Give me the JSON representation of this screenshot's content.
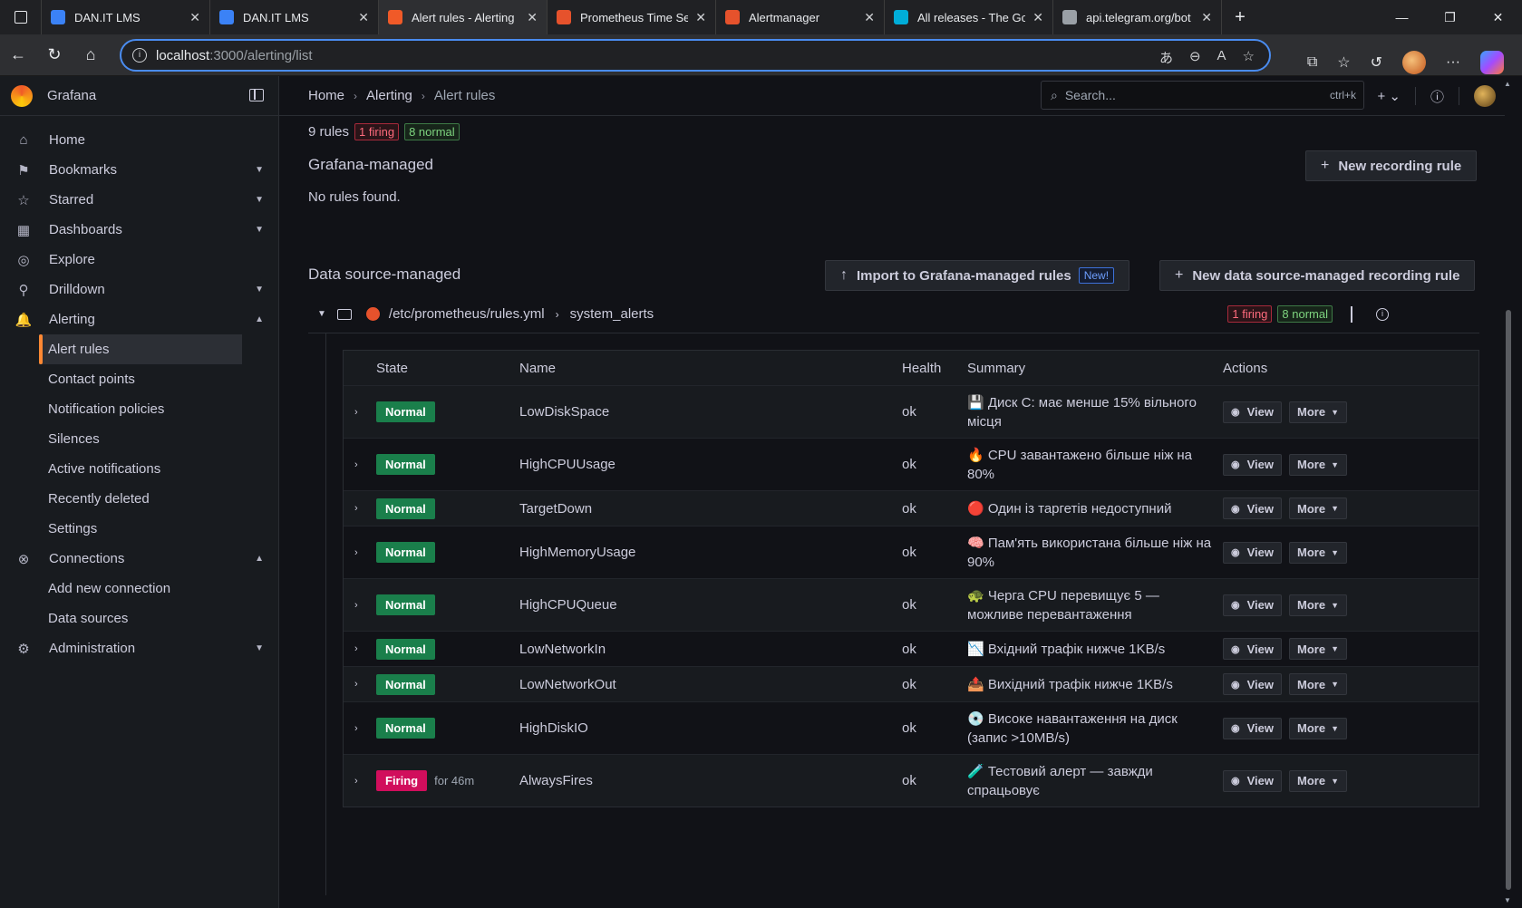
{
  "browser": {
    "tabs": [
      {
        "title": "DAN.IT LMS",
        "favicon_color": "#3b82f6"
      },
      {
        "title": "DAN.IT LMS",
        "favicon_color": "#3b82f6"
      },
      {
        "title": "Alert rules - Alerting",
        "favicon_color": "#f05a28"
      },
      {
        "title": "Prometheus Time Ser",
        "favicon_color": "#e6522c"
      },
      {
        "title": "Alertmanager",
        "favicon_color": "#e6522c"
      },
      {
        "title": "All releases - The Go",
        "favicon_color": "#00add8"
      },
      {
        "title": "api.telegram.org/bot",
        "favicon_color": "#9aa0a6"
      }
    ],
    "url_host": "localhost",
    "url_path": ":3000/alerting/list"
  },
  "sidebar": {
    "brand": "Grafana",
    "items": [
      {
        "label": "Home",
        "icon": "home-icon",
        "glyph": "⌂",
        "chevron": ""
      },
      {
        "label": "Bookmarks",
        "icon": "bookmark-icon",
        "glyph": "⚑",
        "chevron": "▼"
      },
      {
        "label": "Starred",
        "icon": "star-icon",
        "glyph": "☆",
        "chevron": "▼"
      },
      {
        "label": "Dashboards",
        "icon": "dashboards-icon",
        "glyph": "▦",
        "chevron": "▼"
      },
      {
        "label": "Explore",
        "icon": "compass-icon",
        "glyph": "◎",
        "chevron": ""
      },
      {
        "label": "Drilldown",
        "icon": "drilldown-icon",
        "glyph": "⚲",
        "chevron": "▼"
      },
      {
        "label": "Alerting",
        "icon": "bell-icon",
        "glyph": "🔔",
        "chevron": "▲"
      }
    ],
    "alerting_sub": [
      "Alert rules",
      "Contact points",
      "Notification policies",
      "Silences",
      "Active notifications",
      "Recently deleted",
      "Settings"
    ],
    "connections": {
      "label": "Connections",
      "icon": "connections-icon",
      "glyph": "⊗",
      "chevron": "▲"
    },
    "connections_sub": [
      "Add new connection",
      "Data sources"
    ],
    "administration": {
      "label": "Administration",
      "icon": "gear-icon",
      "glyph": "⚙",
      "chevron": "▼"
    }
  },
  "topbar": {
    "breadcrumb": [
      "Home",
      "Alerting",
      "Alert rules"
    ],
    "search_placeholder": "Search...",
    "search_shortcut": "ctrl+k"
  },
  "main": {
    "rules_count": "9 rules",
    "firing_badge": "1 firing",
    "normal_badge": "8 normal",
    "grafana_managed_title": "Grafana-managed",
    "no_rules": "No rules found.",
    "new_recording_rule": "New recording rule",
    "ds_managed_title": "Data source-managed",
    "import_button": "Import to Grafana-managed rules",
    "import_new_tag": "New!",
    "new_ds_recording_rule": "New data source-managed recording rule",
    "group": {
      "file": "/etc/prometheus/rules.yml",
      "name": "system_alerts",
      "firing": "1 firing",
      "normal": "8 normal"
    },
    "columns": [
      "State",
      "Name",
      "Health",
      "Summary",
      "Actions"
    ],
    "view_label": "View",
    "more_label": "More",
    "rules": [
      {
        "state": "Normal",
        "since": "",
        "name": "LowDiskSpace",
        "health": "ok",
        "summary": "💾 Диск C: має менше 15% вільного місця",
        "emoji_color": "#7b5cb8"
      },
      {
        "state": "Normal",
        "since": "",
        "name": "HighCPUUsage",
        "health": "ok",
        "summary": "🔥 CPU завантажено більше ніж на 80%",
        "emoji_color": "#e07a2c"
      },
      {
        "state": "Normal",
        "since": "",
        "name": "TargetDown",
        "health": "ok",
        "summary": "🔴 Один із таргетів недоступний",
        "emoji_color": "#d9303c"
      },
      {
        "state": "Normal",
        "since": "",
        "name": "HighMemoryUsage",
        "health": "ok",
        "summary": "🧠 Пам'ять використана більше ніж на 90%",
        "emoji_color": "#e98cc0"
      },
      {
        "state": "Normal",
        "since": "",
        "name": "HighCPUQueue",
        "health": "ok",
        "summary": "🐢 Черга CPU перевищує 5 — можливе перевантаження",
        "emoji_color": "#4a9a4a"
      },
      {
        "state": "Normal",
        "since": "",
        "name": "LowNetworkIn",
        "health": "ok",
        "summary": "📉 Вхідний трафік нижче 1KB/s",
        "emoji_color": "#d8506a"
      },
      {
        "state": "Normal",
        "since": "",
        "name": "LowNetworkOut",
        "health": "ok",
        "summary": "📤 Вихідний трафік нижче 1KB/s",
        "emoji_color": "#5a8ad8"
      },
      {
        "state": "Normal",
        "since": "",
        "name": "HighDiskIO",
        "health": "ok",
        "summary": "💿 Високе навантаження на диск (запис >10MB/s)",
        "emoji_color": "#9aa0b0"
      },
      {
        "state": "Firing",
        "since": "for 46m",
        "name": "AlwaysFires",
        "health": "ok",
        "summary": "🧪 Тестовий алерт — завжди спрацьовує",
        "emoji_color": "#5fb04a"
      }
    ]
  }
}
